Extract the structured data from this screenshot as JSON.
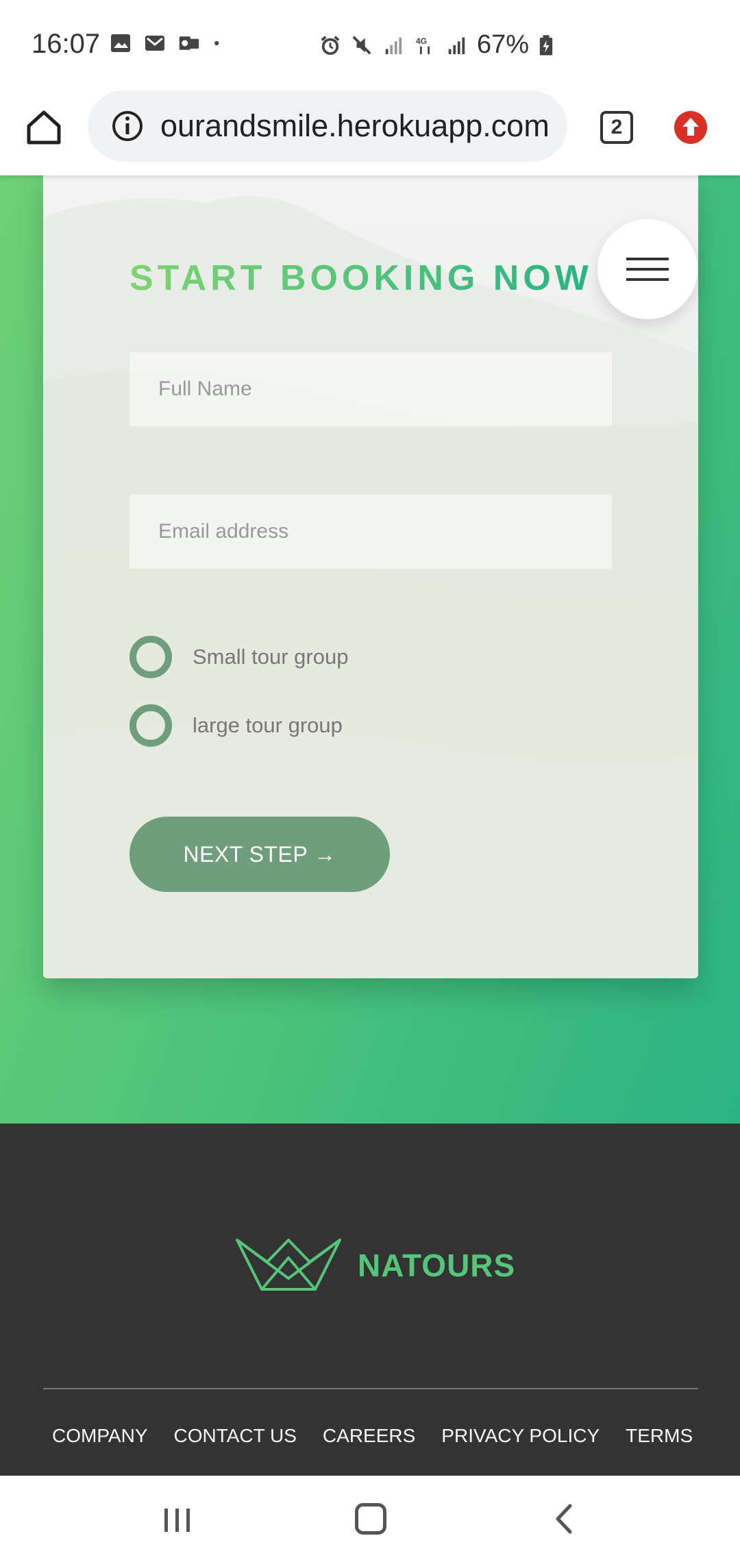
{
  "status_bar": {
    "time": "16:07",
    "battery": "67%",
    "icons": [
      "image-icon",
      "gmail-icon",
      "outlook-icon",
      "dot-icon",
      "alarm-icon",
      "mute-icon",
      "signal-icon",
      "4g-icon",
      "signal-icon",
      "battery-charging-icon"
    ]
  },
  "browser": {
    "url": "ourandsmile.herokuapp.com",
    "tab_count": "2"
  },
  "booking": {
    "title": "START BOOKING NOW",
    "name_placeholder": "Full Name",
    "email_placeholder": "Email address",
    "radio_small": "Small tour group",
    "radio_large": "large tour group",
    "next_button": "NEXT STEP →"
  },
  "footer": {
    "brand": "NATOURS",
    "links": [
      "COMPANY",
      "CONTACT US",
      "CAREERS",
      "PRIVACY POLICY",
      "TERMS"
    ]
  },
  "colors": {
    "accent_green": "#55c57a",
    "gradient_start": "#7ed56f",
    "gradient_end": "#28b485",
    "button_green": "#6e9e7c",
    "footer_bg": "#333333"
  }
}
